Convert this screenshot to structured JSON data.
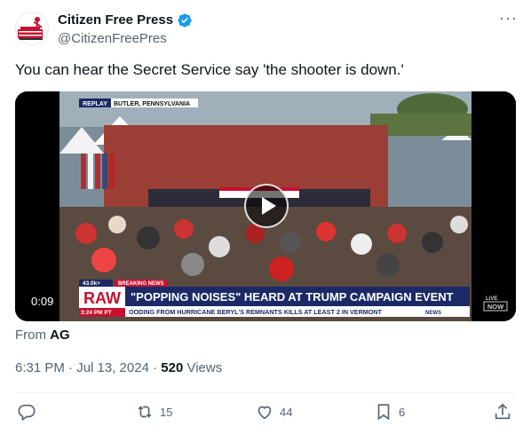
{
  "author": {
    "display_name": "Citizen Free Press",
    "handle": "@CitizenFreePres",
    "verified_badge_icon": "verified-badge-icon",
    "avatar_icon": "avatar-logo"
  },
  "more_icon": "more-icon",
  "tweet": {
    "text": "You can hear the Secret Service say 'the shooter is down.'"
  },
  "video": {
    "duration": "0:09",
    "overlay": {
      "replay_label": "REPLAY",
      "location": "BUTLER, PENNSYLVANIA",
      "viewers": "43.0k+",
      "breaking_label": "BREAKING NEWS",
      "raw_label": "RAW",
      "time": "3:24 PM PT",
      "headline": "\"POPPING NOISES\" HEARD AT TRUMP CAMPAIGN EVENT",
      "ticker": "OODING FROM HURRICANE BERYL'S REMNANTS KILLS AT LEAST 2 IN VERMONT",
      "news_label": "NEWS",
      "network_logo_top": "LiVE",
      "network_logo_bottom": "NOW"
    }
  },
  "source": {
    "prefix": "From",
    "name": "AG"
  },
  "meta": {
    "time_date": "6:31 PM · Jul 13, 2024 · ",
    "views_count": "520",
    "views_label": " Views"
  },
  "actions": {
    "reply_icon": "reply-icon",
    "retweets": "15",
    "likes": "44",
    "bookmarks": "6",
    "share_icon": "share-icon"
  },
  "colors": {
    "verified": "#1d9bf0",
    "secondary_text": "#536471",
    "raw_red": "#c8102e",
    "headline_bg": "#1b2a66"
  }
}
